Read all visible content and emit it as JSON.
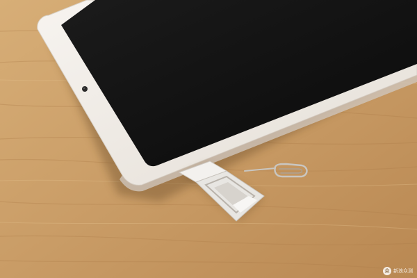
{
  "scene": {
    "subject": "tablet-with-ejected-card-tray",
    "objects": [
      "tablet",
      "front-camera",
      "card-tray",
      "sim-eject-pin",
      "wooden-desk"
    ],
    "colors": {
      "wood_light": "#d9b27c",
      "wood_mid": "#c89a63",
      "wood_dark": "#a77a47",
      "tablet_frame": "#f1ede8",
      "tablet_screen": "#121212",
      "tray_metal": "#e8e6e2"
    }
  },
  "watermark": {
    "icon": "watermark-logo-icon",
    "text": "新浪众测"
  }
}
